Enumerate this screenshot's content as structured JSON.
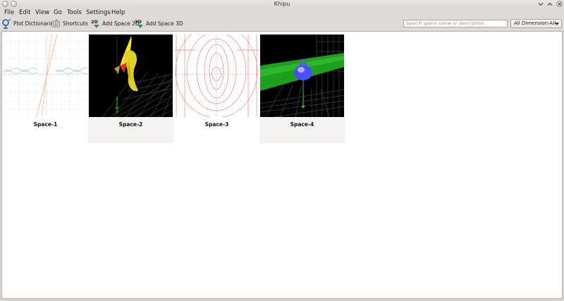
{
  "window": {
    "title": "Khipu"
  },
  "menu": [
    {
      "label": "File"
    },
    {
      "label": "Edit"
    },
    {
      "label": "View"
    },
    {
      "label": "Go"
    },
    {
      "label": "Tools"
    },
    {
      "label": "Settings"
    },
    {
      "label": "Help"
    }
  ],
  "toolbar": {
    "plot_dictionaries": {
      "label": "Plot Dictionaries",
      "icon": "plot-dictionaries-icon"
    },
    "shortcuts": {
      "label": "Shortcuts",
      "icon": "shortcuts-icon"
    },
    "add_space_2d": {
      "label": "Add Space 2D",
      "icon_text": "2D"
    },
    "add_space_3d": {
      "label": "Add Space 3D",
      "icon_text": "3D"
    }
  },
  "search": {
    "placeholder": "Search space name or description"
  },
  "filter": {
    "selected": "All Dimension-All"
  },
  "spaces": [
    {
      "name": "Space-1",
      "kind": "2d-plot"
    },
    {
      "name": "Space-2",
      "kind": "3d-plot"
    },
    {
      "name": "Space-3",
      "kind": "2d-plot"
    },
    {
      "name": "Space-4",
      "kind": "3d-plot"
    }
  ],
  "colors": {
    "accent_green": "#1fa81f",
    "plot_red": "#e4321e",
    "plot_yellow": "#f4e227",
    "plot_blue": "#3c46ff"
  }
}
